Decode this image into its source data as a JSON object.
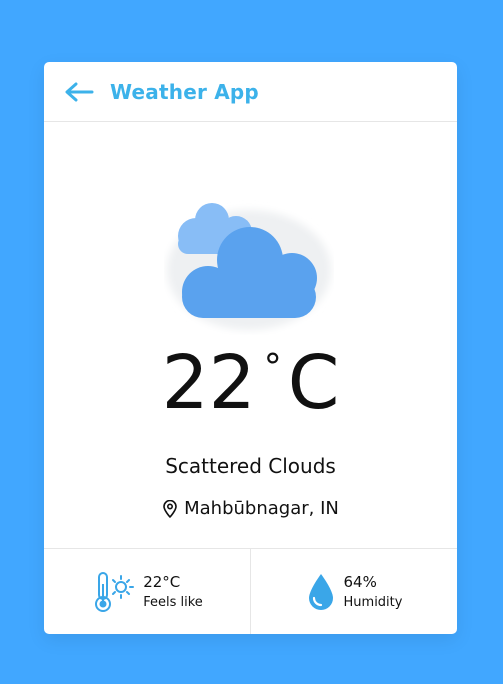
{
  "header": {
    "title": "Weather App",
    "back_icon": "arrow-left-icon"
  },
  "weather": {
    "icon": "scattered-clouds-icon",
    "temperature": "22",
    "unit": "C",
    "degree_symbol": "°",
    "description": "Scattered Clouds",
    "location": "Mahbūbnagar, IN",
    "location_icon": "map-pin-icon"
  },
  "details": {
    "feels_like": {
      "value": "22°C",
      "label": "Feels like",
      "icon": "thermometer-sun-icon"
    },
    "humidity": {
      "value": "64%",
      "label": "Humidity",
      "icon": "water-drop-icon"
    }
  },
  "colors": {
    "background": "#41a7ff",
    "accent": "#3cb2ea",
    "cloud_front": "#5aa2ee",
    "cloud_back": "#88bdf6"
  }
}
